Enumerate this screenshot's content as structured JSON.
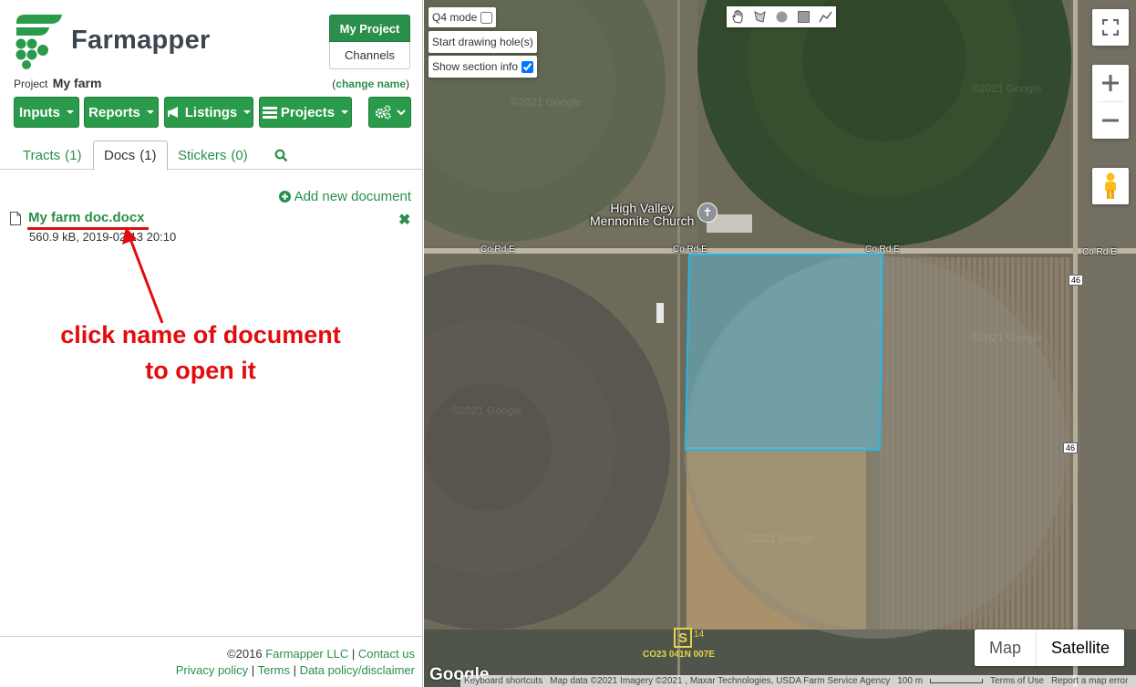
{
  "brand": {
    "name": "Farmapper"
  },
  "project_switch": {
    "my_project": "My Project",
    "channels": "Channels"
  },
  "project": {
    "label": "Project",
    "name": "My farm",
    "change_name": "change name"
  },
  "menu": {
    "inputs": "Inputs",
    "reports": "Reports",
    "listings": "Listings",
    "projects": "Projects"
  },
  "tabs": [
    {
      "label": "Tracts",
      "count": "(1)"
    },
    {
      "label": "Docs",
      "count": "(1)"
    },
    {
      "label": "Stickers",
      "count": "(0)"
    }
  ],
  "docs": {
    "add_new": "Add new document",
    "items": [
      {
        "name": "My farm doc.docx",
        "meta": "560.9 kB, 2019-02-13 20:10"
      }
    ]
  },
  "annotation": {
    "line1": "click name of document",
    "line2": "to open it"
  },
  "footer": {
    "copyright": "©2016",
    "company": "Farmapper LLC",
    "contact": "Contact us",
    "privacy": "Privacy policy",
    "terms": "Terms",
    "data_policy": "Data policy/disclaimer"
  },
  "map": {
    "q4_mode": "Q4 mode",
    "start_drawing_holes": "Start drawing hole(s)",
    "show_section_info": "Show section info",
    "map_type": {
      "map": "Map",
      "satellite": "Satellite"
    },
    "roads": [
      "Co Rd E",
      "Co Rd E",
      "Co Rd E",
      "Co Rd E"
    ],
    "highway": "46",
    "poi": {
      "line1": "High Valley",
      "line2": "Mennonite Church"
    },
    "section": {
      "letter": "S",
      "num": "14",
      "code": "CO23 041N 007E"
    },
    "google": "Google",
    "watermark": "©2021 Google",
    "attribution": {
      "shortcuts": "Keyboard shortcuts",
      "data": "Map data ©2021 Imagery ©2021 , Maxar Technologies, USDA Farm Service Agency",
      "scale": "100 m",
      "terms": "Terms of Use",
      "report": "Report a map error"
    },
    "colors": {
      "tract_fill": "#5ec7e8",
      "tract_stroke": "#27b5e6"
    }
  }
}
